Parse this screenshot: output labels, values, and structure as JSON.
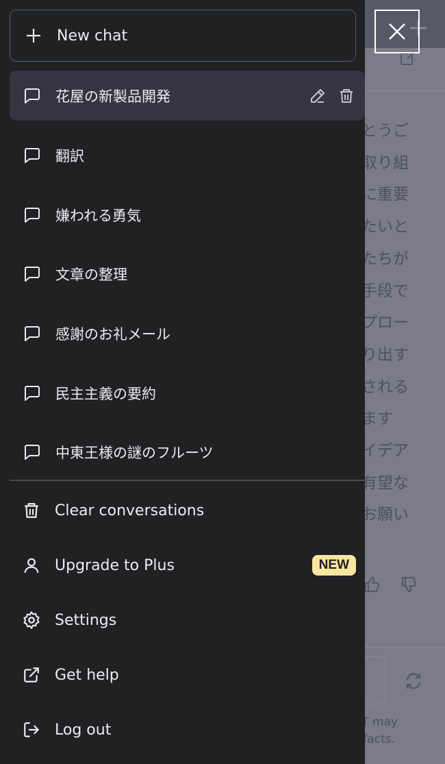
{
  "sidebar": {
    "new_chat_label": "New chat",
    "conversations": [
      {
        "label": "花屋の新製品開発",
        "active": true
      },
      {
        "label": "翻訳"
      },
      {
        "label": "嫌われる勇気"
      },
      {
        "label": "文章の整理"
      },
      {
        "label": "感謝のお礼メール"
      },
      {
        "label": "民主主義の要約"
      },
      {
        "label": "中東王様の謎のフルーツ"
      }
    ],
    "menu": [
      {
        "label": "Clear conversations",
        "icon": "trash-icon"
      },
      {
        "label": "Upgrade to Plus",
        "icon": "user-icon",
        "badge": "NEW"
      },
      {
        "label": "Settings",
        "icon": "gear-icon"
      },
      {
        "label": "Get help",
        "icon": "external-link-icon"
      },
      {
        "label": "Log out",
        "icon": "logout-icon"
      }
    ]
  },
  "background": {
    "text_lines": [
      "とうご",
      "取り組",
      "に重要",
      "たいと",
      "たちが",
      "手段で",
      "プロー",
      "り出す",
      "される",
      "ます",
      "イデア",
      "有望な",
      "お願い"
    ],
    "footer_lines": [
      "PT may",
      "r facts."
    ]
  },
  "colors": {
    "sidebar_bg": "#202123",
    "active_bg": "#343541",
    "text": "#ececf1",
    "badge_bg": "#fae69e",
    "overlay": "#7b7c87"
  }
}
